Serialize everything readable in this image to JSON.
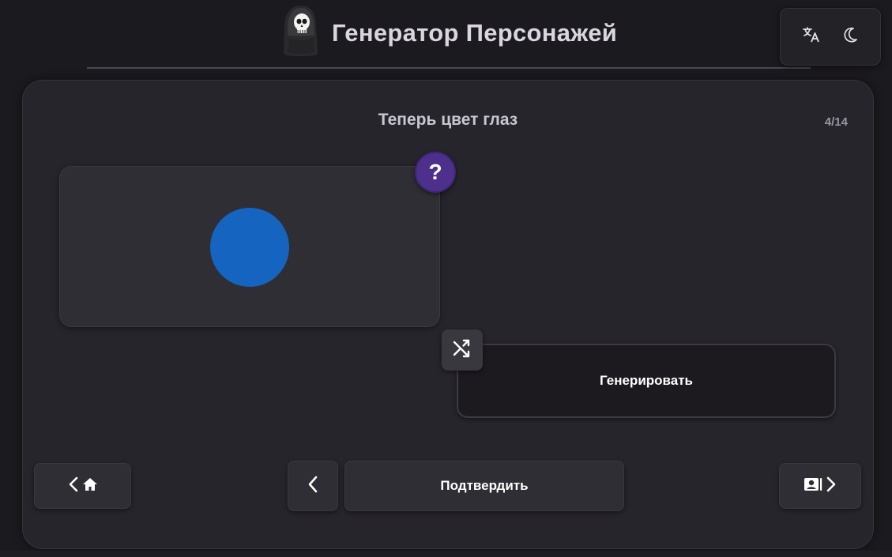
{
  "header": {
    "title": "Генератор Персонажей",
    "logo_icon": "grim-reaper-logo",
    "tools": [
      {
        "name": "translate-icon"
      },
      {
        "name": "moon-icon"
      }
    ]
  },
  "step": {
    "title": "Теперь цвет глаз",
    "counter": "4/14"
  },
  "preview": {
    "eye_color": "#1565c0",
    "help_label": "?"
  },
  "actions": {
    "shuffle_icon": "shuffle-icon",
    "generate_label": "Генерировать"
  },
  "navigation": {
    "home_icons": [
      "chevron-left-icon",
      "home-icon"
    ],
    "prev_icon": "chevron-left-icon",
    "confirm_label": "Подтвердить",
    "next_icons": [
      "character-card-icon",
      "chevron-right-icon"
    ]
  },
  "colors": {
    "background": "#1b1a1e",
    "panel": "#26252b",
    "card": "#302e35",
    "help_accent": "#4d2f8c",
    "text": "#d9d6e0"
  }
}
